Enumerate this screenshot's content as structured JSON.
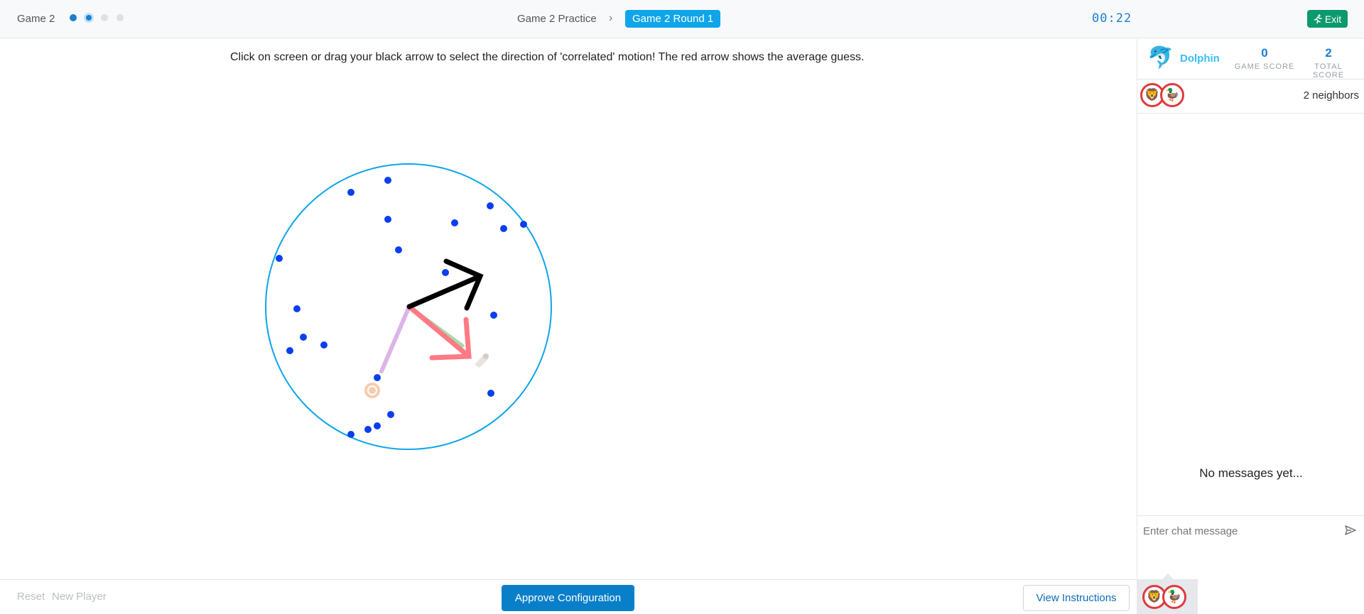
{
  "header": {
    "game_label": "Game 2",
    "steps": [
      "done",
      "current",
      "todo",
      "todo"
    ],
    "breadcrumb_practice": "Game 2 Practice",
    "breadcrumb_chevron": "›",
    "breadcrumb_round": "Game 2 Round 1",
    "timer": "00:22",
    "exit_label": "Exit"
  },
  "instruction": "Click on screen or drag your black arrow to select the direction of 'correlated' motion! The red arrow shows the average guess.",
  "sidebar": {
    "player_name": "Dolphin",
    "player_avatar": "🐬",
    "game_score": "0",
    "game_score_label": "GAME SCORE",
    "total_score": "2",
    "total_score_label": "TOTAL SCORE",
    "neighbor_avatars": [
      "🦁",
      "🦆"
    ],
    "neighbors_count": "2 neighbors",
    "no_messages": "No messages yet...",
    "chat_placeholder": "Enter chat message"
  },
  "footer": {
    "reset_label": "Reset",
    "new_player_label": "New Player",
    "approve_label": "Approve Configuration",
    "view_instructions_label": "View Instructions"
  },
  "colors": {
    "accent": "#0a7fc9",
    "dots": "#0a3ff0",
    "circle": "#0ea5e9",
    "my_arrow": "#000000",
    "average_arrow": "#ff7a85",
    "neighbor_lion_arrow": "#dcb4e8",
    "neighbor_duck_arrow": "#a8dba8",
    "exit": "#0b9a6d"
  }
}
